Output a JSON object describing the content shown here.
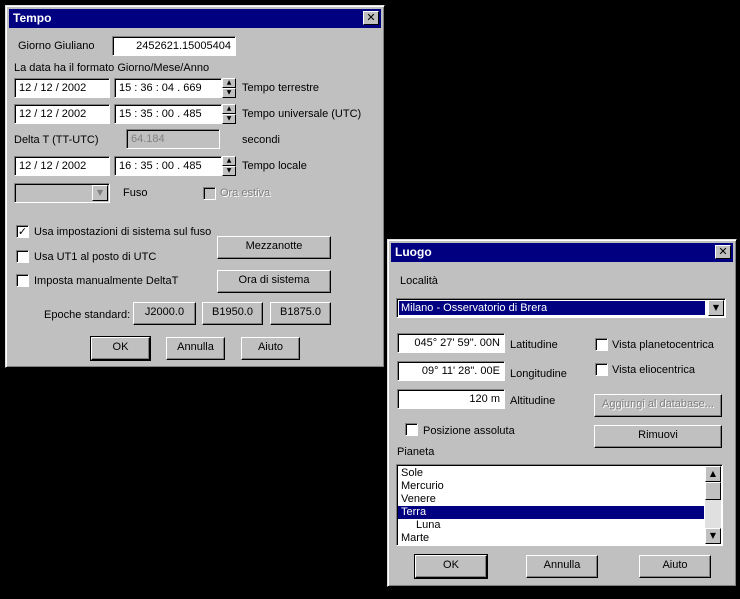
{
  "tempo": {
    "title": "Tempo",
    "julian_label": "Giorno Giuliano",
    "julian_value": "2452621.15005404",
    "format_note": "La data ha il formato Giorno/Mese/Anno",
    "tt_date": "12 /  12 /    2002",
    "tt_time": "15  :  36  :  04  .  669",
    "tt_label": "Tempo terrestre",
    "utc_date": "12 /  12 /    2002",
    "utc_time": "15  :  35  :  00  .  485",
    "utc_label": "Tempo universale (UTC)",
    "deltat_label": "Delta T (TT-UTC)",
    "deltat_value": "64.184",
    "deltat_unit": "secondi",
    "local_date": "12 /  12 /    2002",
    "local_time": "16  :  35  :  00  .  485",
    "local_label": "Tempo locale",
    "fuso_label": "Fuso",
    "ora_estiva_label": "Ora estiva",
    "use_system_tz_label": "Usa impostazioni di sistema sul fuso",
    "use_system_tz_checked": true,
    "use_ut1_label": "Usa UT1 al posto di UTC",
    "manual_deltat_label": "Imposta manualmente DeltaT",
    "mezzanotte_btn": "Mezzanotte",
    "ora_sistema_btn": "Ora di sistema",
    "epoche_label": "Epoche standard:",
    "j2000_btn": "J2000.0",
    "b1950_btn": "B1950.0",
    "b1875_btn": "B1875.0",
    "ok_btn": "OK",
    "annulla_btn": "Annulla",
    "aiuto_btn": "Aiuto",
    "close_glyph": "✕"
  },
  "luogo": {
    "title": "Luogo",
    "localita_label": "Località",
    "localita_value": "Milano - Osservatorio di Brera",
    "lat_value": "045°  27'  59\".  00N",
    "lat_label": "Latitudine",
    "lon_value": "09°  11'  28\".  00E",
    "lon_label": "Longitudine",
    "alt_value": "120 m",
    "alt_label": "Altitudine",
    "vista_planetocentrica": "Vista planetocentrica",
    "vista_eliocentrica": "Vista eliocentrica",
    "aggiungi_btn": "Aggiungi al database...",
    "rimuovi_btn": "Rimuovi",
    "posizione_assoluta": "Posizione assoluta",
    "pianeta_label": "Pianeta",
    "planets": [
      "Sole",
      "Mercurio",
      "Venere",
      "Terra",
      "Luna",
      "Marte"
    ],
    "selected_planet": "Terra",
    "ok_btn": "OK",
    "annulla_btn": "Annulla",
    "aiuto_btn": "Aiuto",
    "close_glyph": "✕"
  },
  "icons": {
    "check": "✓",
    "spin_up": "▲",
    "spin_down": "▼",
    "dropdown": "▼"
  }
}
